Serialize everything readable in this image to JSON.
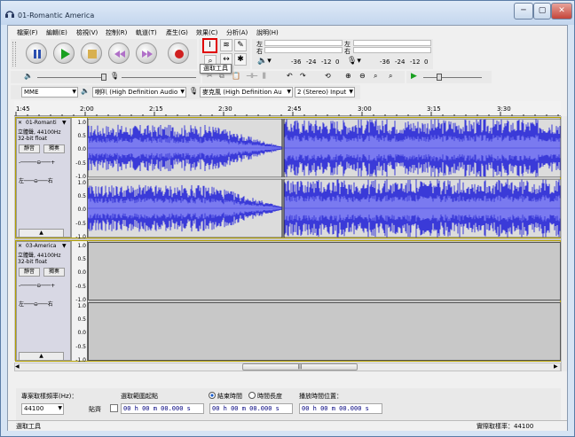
{
  "window": {
    "title": "01-Romantic America",
    "minimize": "─",
    "maximize": "▢",
    "close": "✕"
  },
  "menu": [
    "檔案(F)",
    "編輯(E)",
    "檢視(V)",
    "控制(R)",
    "軌道(T)",
    "產生(G)",
    "效果(C)",
    "分析(A)",
    "說明(H)"
  ],
  "meters": {
    "left": "左",
    "right": "右",
    "scale": [
      "-36",
      "-24",
      "-12",
      "0"
    ]
  },
  "device": {
    "host": "MME",
    "output": "喇叭 (High Definition Audio",
    "input": "麥克風 (High Definition Au",
    "channels": "2 (Stereo) Input"
  },
  "tooltip": "選取工具",
  "ruler": [
    "1:45",
    "2:00",
    "2:15",
    "2:30",
    "2:45",
    "3:00",
    "3:15",
    "3:30"
  ],
  "scale": [
    "1.0",
    "0.5",
    "0.0",
    "-0.5",
    "-1.0"
  ],
  "tracks": [
    {
      "name": "01-Romanti",
      "info": "立體聲, 44100Hz",
      "format": "32-bit float",
      "mute": "靜音",
      "solo": "獨奏"
    },
    {
      "name": "03-America",
      "info": "立體聲, 44100Hz",
      "format": "32-bit float",
      "mute": "靜音",
      "solo": "獨奏"
    }
  ],
  "selection": {
    "rate_label": "專案取樣頻率(Hz)：",
    "rate_value": "44100",
    "snap_label": "貼齊",
    "start_label": "選取範圍起點",
    "end_label": "結束時間",
    "length_label": "時間長度",
    "pos_label": "播放時間位置：",
    "time_value": "00 h 00 m 00.000 s"
  },
  "status": {
    "left": "選取工具",
    "right": "實際取樣率：44100"
  },
  "colors": {
    "wave": "#3a3ad8",
    "wave_light": "#7a7af0",
    "selected_border": "#e00000"
  }
}
